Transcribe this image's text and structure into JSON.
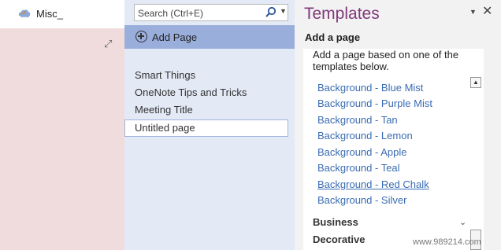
{
  "notebook": {
    "name": "Misc_",
    "icon": "notebook-cloud-icon"
  },
  "search": {
    "placeholder": "Search (Ctrl+E)",
    "icon": "search-icon"
  },
  "page_list": {
    "add_page_label": "Add Page",
    "pages": [
      {
        "title": "Smart Things",
        "selected": false
      },
      {
        "title": "OneNote Tips and Tricks",
        "selected": false
      },
      {
        "title": "Meeting Title",
        "selected": false
      },
      {
        "title": "Untitled page",
        "selected": true
      }
    ]
  },
  "templates": {
    "title": "Templates",
    "section_heading": "Add a page",
    "description": "Add a page based on one of the templates below.",
    "items": [
      "Background - Blue Mist",
      "Background - Purple Mist",
      "Background - Tan",
      "Background - Lemon",
      "Background - Apple",
      "Background - Teal",
      "Background - Red Chalk",
      "Background - Silver"
    ],
    "hovered_item_index": 6,
    "categories": [
      "Business",
      "Decorative"
    ],
    "accent_color": "#80397b",
    "link_color": "#3a6cb3"
  },
  "colors": {
    "section_canvas": "#f0dcdc",
    "page_list_bg": "#e3eaf6",
    "add_page_bar": "#9aaedc"
  },
  "watermark": "www.989214.com"
}
